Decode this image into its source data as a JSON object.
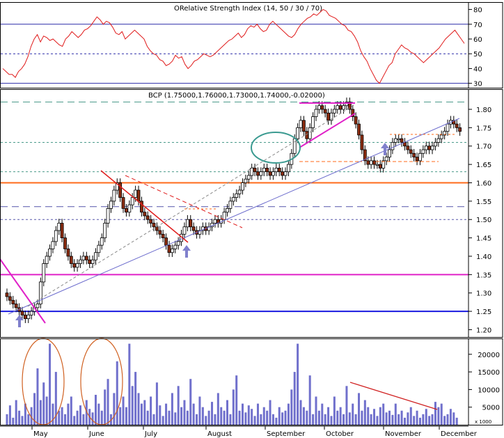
{
  "chart_data": [
    {
      "panel": "indicator",
      "type": "line",
      "title_overlap_text": "ORelative Strength Index (14, 50 / 30 / 70)",
      "yticks": [
        80,
        70,
        60,
        50,
        40,
        30
      ],
      "ylim": [
        27,
        85
      ],
      "levels": [
        70,
        50,
        30
      ],
      "color": "#e01b1b",
      "series": [
        {
          "values": [
            40,
            38,
            36,
            36,
            34,
            38,
            40,
            43,
            48,
            55,
            60,
            63,
            58,
            62,
            61,
            59,
            60,
            58,
            56,
            55,
            60,
            62,
            65,
            63,
            61,
            63,
            66,
            67,
            69,
            72,
            75,
            73,
            70,
            72,
            71,
            68,
            64,
            63,
            65,
            60,
            62,
            64,
            66,
            64,
            62,
            60,
            55,
            52,
            50,
            49,
            46,
            45,
            42,
            43,
            45,
            49,
            47,
            48,
            43,
            40,
            42,
            45,
            46,
            48,
            50,
            49,
            48,
            49,
            51,
            53,
            55,
            57,
            59,
            60,
            62,
            64,
            61,
            63,
            67,
            69,
            68,
            70,
            67,
            65,
            66,
            70,
            72,
            70,
            68,
            66,
            64,
            62,
            61,
            63,
            67,
            70,
            72,
            74,
            75,
            77,
            76,
            78,
            80,
            79,
            76,
            75,
            74,
            72,
            70,
            69,
            66,
            65,
            62,
            58,
            52,
            48,
            45,
            40,
            36,
            32,
            30,
            34,
            38,
            42,
            44,
            50,
            53,
            56,
            54,
            53,
            51,
            50,
            48,
            46,
            44,
            46,
            48,
            50,
            52,
            54,
            57,
            60,
            62,
            64,
            66,
            63,
            60,
            57
          ]
        }
      ]
    },
    {
      "panel": "price",
      "type": "candlestick",
      "title": "BCP (1.75000,1.76000,1.73000,1.74000,-0.02000)",
      "yticks": [
        1.8,
        1.75,
        1.7,
        1.65,
        1.6,
        1.55,
        1.5,
        1.45,
        1.4,
        1.35,
        1.3,
        1.25,
        1.2
      ],
      "ylim": [
        1.18,
        1.855
      ],
      "up_color": "#ffffff",
      "down_color": "#8b2c10",
      "closes": [
        1.29,
        1.28,
        1.27,
        1.26,
        1.25,
        1.24,
        1.23,
        1.24,
        1.25,
        1.26,
        1.27,
        1.33,
        1.38,
        1.4,
        1.42,
        1.44,
        1.47,
        1.49,
        1.45,
        1.42,
        1.4,
        1.38,
        1.37,
        1.38,
        1.39,
        1.4,
        1.39,
        1.38,
        1.39,
        1.41,
        1.43,
        1.45,
        1.49,
        1.53,
        1.55,
        1.58,
        1.6,
        1.56,
        1.53,
        1.52,
        1.54,
        1.56,
        1.58,
        1.55,
        1.52,
        1.51,
        1.5,
        1.49,
        1.48,
        1.47,
        1.46,
        1.45,
        1.43,
        1.41,
        1.42,
        1.43,
        1.44,
        1.46,
        1.48,
        1.5,
        1.48,
        1.47,
        1.46,
        1.47,
        1.48,
        1.47,
        1.48,
        1.49,
        1.5,
        1.49,
        1.5,
        1.52,
        1.53,
        1.55,
        1.56,
        1.57,
        1.58,
        1.6,
        1.61,
        1.62,
        1.64,
        1.63,
        1.62,
        1.63,
        1.64,
        1.63,
        1.62,
        1.63,
        1.64,
        1.63,
        1.62,
        1.63,
        1.65,
        1.68,
        1.72,
        1.75,
        1.77,
        1.74,
        1.72,
        1.75,
        1.78,
        1.8,
        1.81,
        1.8,
        1.79,
        1.77,
        1.79,
        1.8,
        1.81,
        1.8,
        1.81,
        1.82,
        1.8,
        1.78,
        1.76,
        1.73,
        1.69,
        1.66,
        1.65,
        1.66,
        1.65,
        1.65,
        1.64,
        1.66,
        1.67,
        1.69,
        1.71,
        1.72,
        1.72,
        1.71,
        1.7,
        1.69,
        1.68,
        1.67,
        1.66,
        1.68,
        1.69,
        1.7,
        1.69,
        1.7,
        1.71,
        1.72,
        1.73,
        1.74,
        1.76,
        1.77,
        1.76,
        1.75,
        1.74
      ],
      "horizontal_lines": [
        {
          "value": 1.82,
          "style": "dashed",
          "color": "#4a9a8a"
        },
        {
          "value": 1.71,
          "style": "dotted",
          "color": "#4a9a8a"
        },
        {
          "value": 1.63,
          "style": "dotted",
          "color": "#4a9a8a"
        },
        {
          "value": 1.6,
          "style": "solid",
          "color": "#ff6a1a"
        },
        {
          "value": 1.535,
          "style": "dashed",
          "color": "#5555aa"
        },
        {
          "value": 1.5,
          "style": "dotted",
          "color": "#5555aa"
        },
        {
          "value": 1.35,
          "style": "solid",
          "color": "#e020c8"
        },
        {
          "value": 1.25,
          "style": "solid",
          "color": "#1a1ae0"
        }
      ],
      "annotations": [
        "support-arrow-may",
        "support-arrow-july",
        "support-arrow-october",
        "consolidation-ellipse-september",
        "rising-trendline",
        "falling-wedge-june-july",
        "rising-wedge-september-october"
      ]
    },
    {
      "panel": "volume",
      "type": "bar",
      "yticks": [
        20000,
        15000,
        10000,
        5000
      ],
      "scale_label": "x 1000",
      "ylim": [
        0,
        24500
      ],
      "color": "#7070cc",
      "values": [
        3000,
        5500,
        2000,
        7000,
        4000,
        2500,
        6000,
        3000,
        5000,
        9000,
        16000,
        7000,
        12000,
        8000,
        23000,
        6000,
        15000,
        4000,
        5000,
        3000,
        6000,
        8000,
        2500,
        4000,
        5500,
        3000,
        7000,
        4500,
        3500,
        8500,
        6000,
        4000,
        10000,
        13000,
        3000,
        9000,
        18000,
        5000,
        8000,
        5000,
        23000,
        11000,
        15000,
        9000,
        6000,
        7000,
        4000,
        8000,
        3000,
        12000,
        5500,
        2500,
        6000,
        4000,
        9000,
        3500,
        11000,
        5000,
        7000,
        4000,
        13000,
        6000,
        3000,
        8000,
        5000,
        2500,
        4000,
        6500,
        3000,
        9000,
        5000,
        4000,
        7000,
        3000,
        10000,
        14000,
        4000,
        6000,
        3500,
        5500,
        4500,
        2500,
        6000,
        3000,
        5000,
        4000,
        7000,
        3000,
        2000,
        5000,
        3500,
        4000,
        6000,
        10000,
        15000,
        23000,
        7000,
        5000,
        4000,
        14000,
        3000,
        8000,
        4000,
        6000,
        3000,
        5000,
        2500,
        8000,
        4000,
        5000,
        3000,
        11000,
        3500,
        6000,
        3000,
        9000,
        4000,
        7000,
        5000,
        3000,
        4500,
        2500,
        5000,
        6000,
        3500,
        4000,
        2800,
        6000,
        3000,
        4000,
        2000,
        3500,
        5000,
        2500,
        4000,
        2000,
        3000,
        4500,
        2500,
        3000,
        6500,
        5000,
        6000,
        2500,
        3000,
        4500,
        3500,
        2000
      ]
    }
  ],
  "x_axis": {
    "labels": [
      "May",
      "June",
      "July",
      "August",
      "September",
      "October",
      "November",
      "December"
    ]
  }
}
